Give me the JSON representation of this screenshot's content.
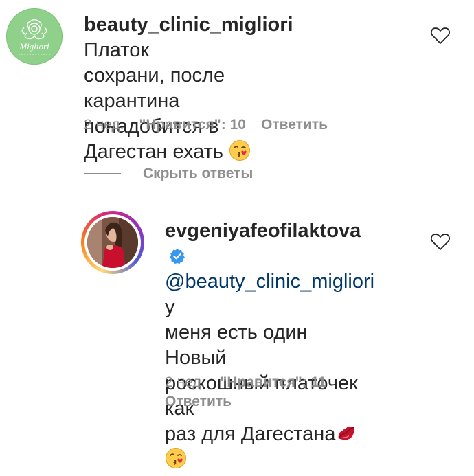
{
  "comment1": {
    "username": "beauty_clinic_migliori",
    "avatar_text": "Migliori",
    "lines": [
      " Платок",
      "сохрани, после карантина",
      "понадобится в Дагестан ехать "
    ],
    "time": "2 нед.",
    "likes": "\"Нравится\": 10",
    "reply": "Ответить",
    "emoji": "kissing-face-emoji"
  },
  "hide_replies": "Скрыть ответы",
  "reply1": {
    "username": "evgeniyafeofilaktova",
    "mention": "@beauty_clinic_migliori",
    "lines": [
      " у",
      "меня есть один Новый",
      "роскошный платочек как",
      "раз для Дагестана"
    ],
    "time": "2 нед.",
    "likes": "\"Нравится\": 11",
    "reply": "Ответить",
    "verified": "verified-badge-icon",
    "emojis": [
      "lips-emoji",
      "kissing-face-emoji"
    ]
  },
  "colors": {
    "text": "#262626",
    "meta": "#8e8e8e",
    "mention": "#00376b",
    "verified": "#3897f0"
  }
}
